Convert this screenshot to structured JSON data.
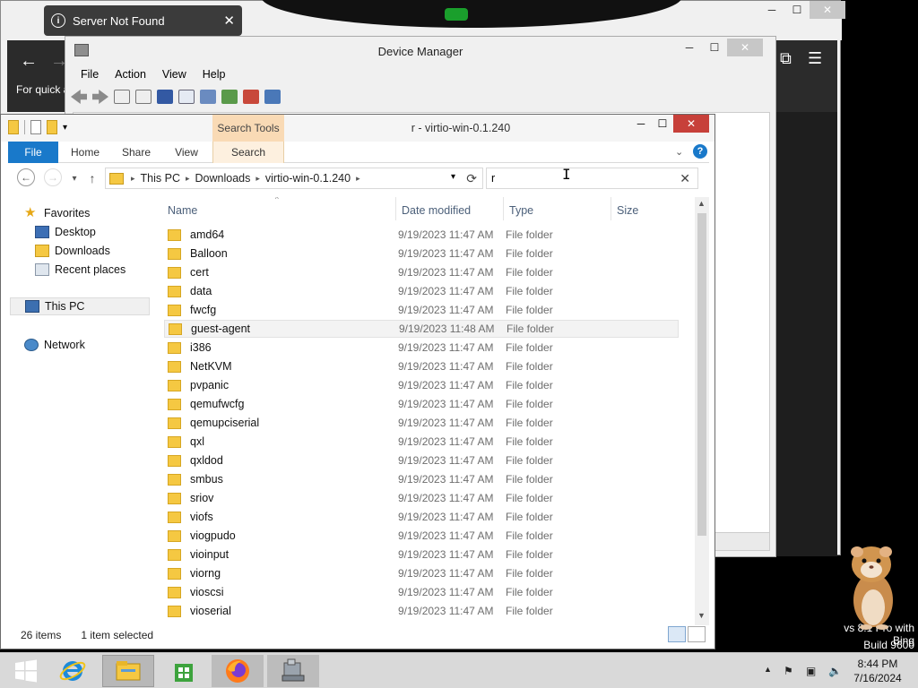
{
  "toast": {
    "message": "Server Not Found"
  },
  "browser": {
    "quick_text": "For quick a"
  },
  "device_manager": {
    "title": "Device Manager",
    "menu": [
      "File",
      "Action",
      "View",
      "Help"
    ]
  },
  "explorer": {
    "title": "r - virtio-win-0.1.240",
    "contextual_tab": "Search Tools",
    "ribbon_tabs": [
      "File",
      "Home",
      "Share",
      "View",
      "Search"
    ],
    "breadcrumb": [
      "This PC",
      "Downloads",
      "virtio-win-0.1.240"
    ],
    "search_value": "r",
    "nav": {
      "favorites": "Favorites",
      "desktop": "Desktop",
      "downloads": "Downloads",
      "recent": "Recent places",
      "this_pc": "This PC",
      "network": "Network"
    },
    "columns": [
      "Name",
      "Date modified",
      "Type",
      "Size"
    ],
    "files": [
      {
        "name": "amd64",
        "date": "9/19/2023 11:47 AM",
        "type": "File folder"
      },
      {
        "name": "Balloon",
        "date": "9/19/2023 11:47 AM",
        "type": "File folder"
      },
      {
        "name": "cert",
        "date": "9/19/2023 11:47 AM",
        "type": "File folder"
      },
      {
        "name": "data",
        "date": "9/19/2023 11:47 AM",
        "type": "File folder"
      },
      {
        "name": "fwcfg",
        "date": "9/19/2023 11:47 AM",
        "type": "File folder"
      },
      {
        "name": "guest-agent",
        "date": "9/19/2023 11:48 AM",
        "type": "File folder"
      },
      {
        "name": "i386",
        "date": "9/19/2023 11:47 AM",
        "type": "File folder"
      },
      {
        "name": "NetKVM",
        "date": "9/19/2023 11:47 AM",
        "type": "File folder"
      },
      {
        "name": "pvpanic",
        "date": "9/19/2023 11:47 AM",
        "type": "File folder"
      },
      {
        "name": "qemufwcfg",
        "date": "9/19/2023 11:47 AM",
        "type": "File folder"
      },
      {
        "name": "qemupciserial",
        "date": "9/19/2023 11:47 AM",
        "type": "File folder"
      },
      {
        "name": "qxl",
        "date": "9/19/2023 11:47 AM",
        "type": "File folder"
      },
      {
        "name": "qxldod",
        "date": "9/19/2023 11:47 AM",
        "type": "File folder"
      },
      {
        "name": "smbus",
        "date": "9/19/2023 11:47 AM",
        "type": "File folder"
      },
      {
        "name": "sriov",
        "date": "9/19/2023 11:47 AM",
        "type": "File folder"
      },
      {
        "name": "viofs",
        "date": "9/19/2023 11:47 AM",
        "type": "File folder"
      },
      {
        "name": "viogpudo",
        "date": "9/19/2023 11:47 AM",
        "type": "File folder"
      },
      {
        "name": "vioinput",
        "date": "9/19/2023 11:47 AM",
        "type": "File folder"
      },
      {
        "name": "viorng",
        "date": "9/19/2023 11:47 AM",
        "type": "File folder"
      },
      {
        "name": "vioscsi",
        "date": "9/19/2023 11:47 AM",
        "type": "File folder"
      },
      {
        "name": "vioserial",
        "date": "9/19/2023 11:47 AM",
        "type": "File folder"
      }
    ],
    "hovered_file": "guest-agent",
    "status_items": "26 items",
    "status_selected": "1 item selected"
  },
  "desktop": {
    "watermark_line1": "vs 8.1 Pro with Bing",
    "watermark_line2": "Build 9600"
  },
  "taskbar": {
    "time": "8:44 PM",
    "date": "7/16/2024",
    "apps": [
      "start",
      "internet-explorer",
      "file-explorer",
      "store",
      "firefox",
      "device-manager"
    ]
  },
  "colors": {
    "accent": "#1979ca",
    "close_red": "#c7403a",
    "search_tools": "#f9dab5",
    "folder": "#f5c842"
  }
}
